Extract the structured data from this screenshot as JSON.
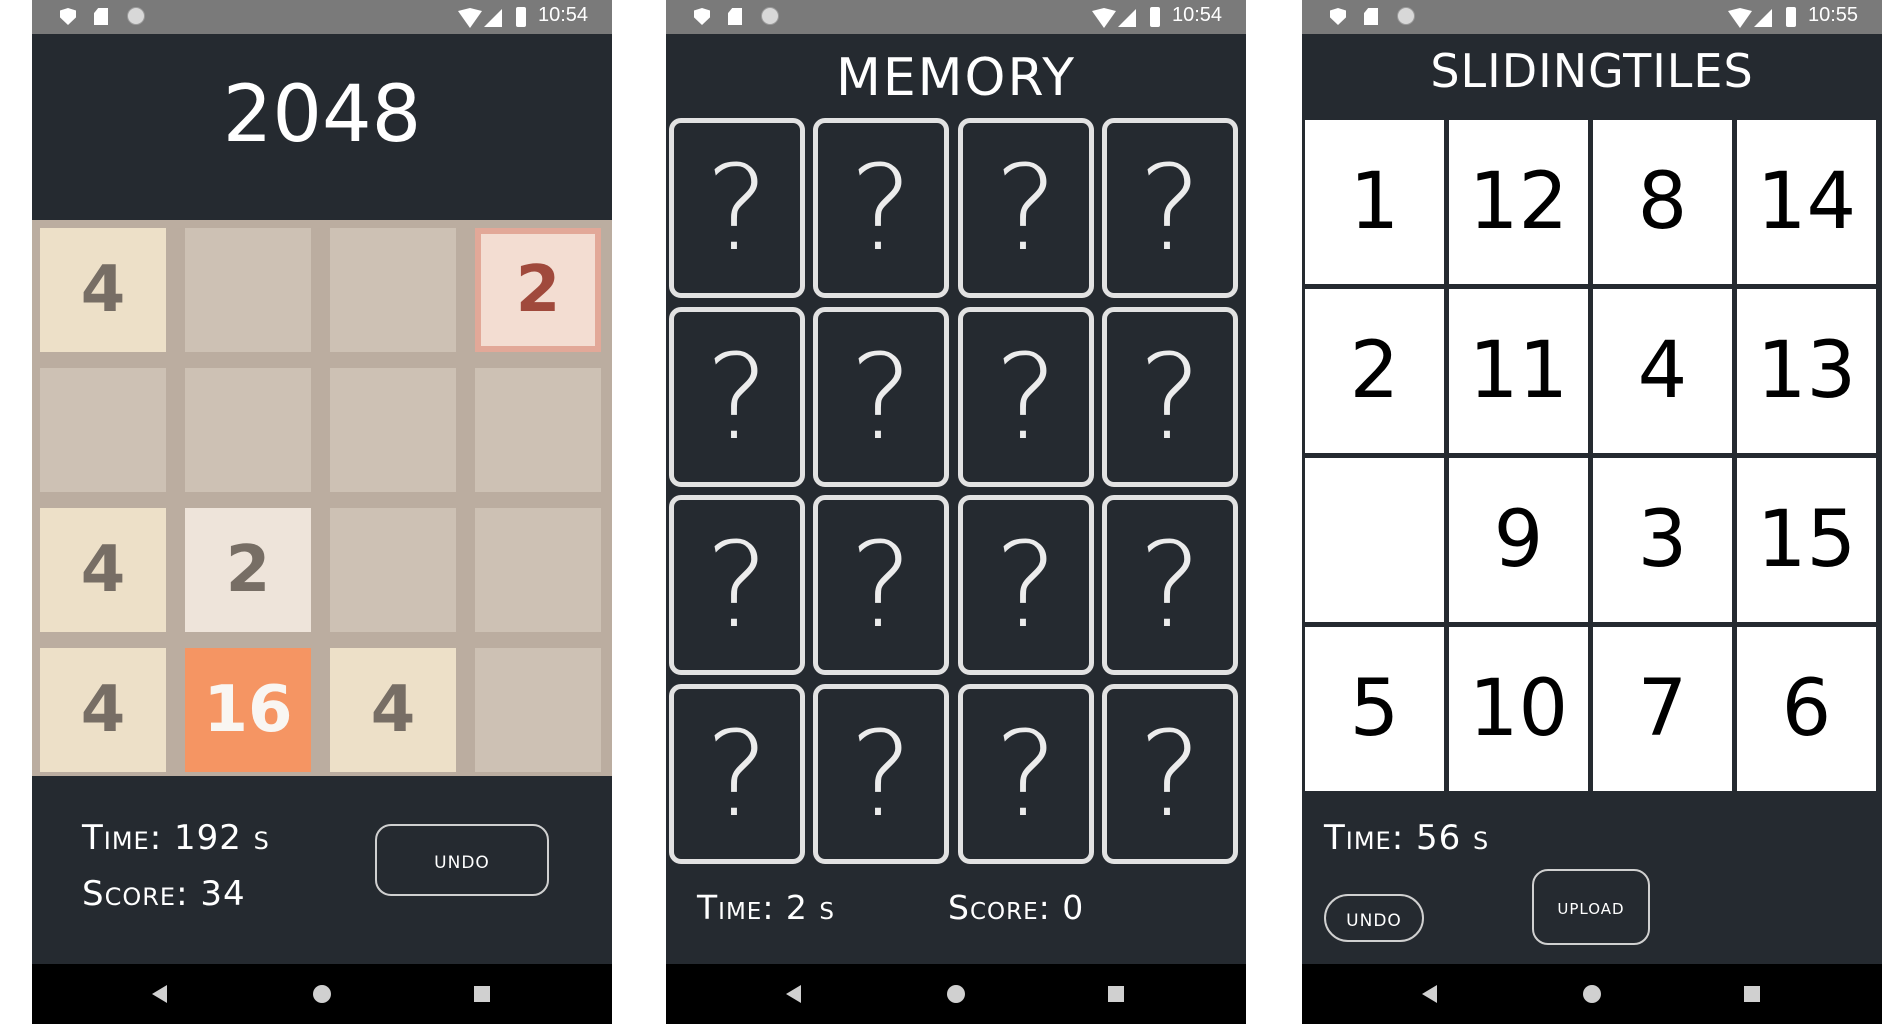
{
  "status_bars": [
    {
      "time": "10:54"
    },
    {
      "time": "10:54"
    },
    {
      "time": "10:55"
    }
  ],
  "game_2048": {
    "title": "2048",
    "board": [
      [
        "4",
        "",
        "",
        "2"
      ],
      [
        "",
        "",
        "",
        ""
      ],
      [
        "4",
        "2",
        "",
        ""
      ],
      [
        "4",
        "16",
        "4",
        ""
      ]
    ],
    "time_text": "Time: 192 s",
    "score_text": "Score: 34",
    "undo_label": "undo",
    "colors": {
      "board": "#bbada0",
      "empty": "#cdc1b4",
      "tile_2": "#eee4da",
      "tile_4": "#ede0c8",
      "tile_16": "#f59563",
      "new_tile": "#f3ddd2"
    }
  },
  "memory": {
    "title": "MEMORY",
    "cards": [
      "?",
      "?",
      "?",
      "?",
      "?",
      "?",
      "?",
      "?",
      "?",
      "?",
      "?",
      "?",
      "?",
      "?",
      "?",
      "?"
    ],
    "time_text": "Time: 2 s",
    "score_text": "Score: 0"
  },
  "sliding_tiles": {
    "title": "SLIDINGTILES",
    "board": [
      [
        "1",
        "12",
        "8",
        "14"
      ],
      [
        "2",
        "11",
        "4",
        "13"
      ],
      [
        "",
        "9",
        "3",
        "15"
      ],
      [
        "5",
        "10",
        "7",
        "6"
      ]
    ],
    "time_text": "Time: 56 s",
    "undo_label": "undo",
    "upload_label": "upload"
  },
  "nav_icons": [
    "back-icon",
    "home-icon",
    "recent-apps-icon"
  ]
}
